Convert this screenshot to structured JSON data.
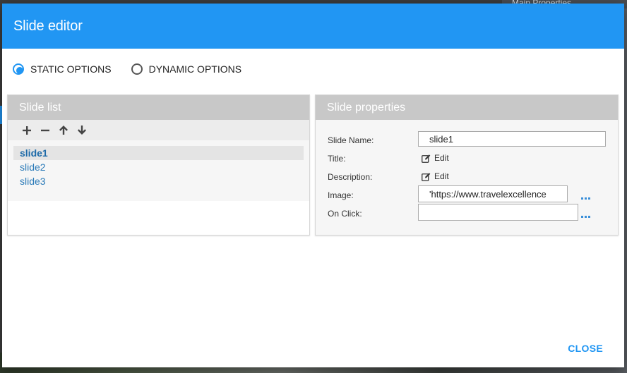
{
  "background": {
    "panel_title": "Main Properties"
  },
  "modal": {
    "title": "Slide editor",
    "options": [
      {
        "label": "STATIC OPTIONS",
        "checked": true
      },
      {
        "label": "DYNAMIC OPTIONS",
        "checked": false
      }
    ],
    "close_label": "CLOSE"
  },
  "slide_list": {
    "title": "Slide list",
    "toolbar": [
      "plus-icon",
      "minus-icon",
      "arrow-up-icon",
      "arrow-down-icon"
    ],
    "items": [
      {
        "label": "slide1",
        "selected": true
      },
      {
        "label": "slide2",
        "selected": false
      },
      {
        "label": "slide3",
        "selected": false
      }
    ]
  },
  "slide_properties": {
    "title": "Slide properties",
    "name_label": "Slide Name:",
    "name_value": "slide1",
    "title_label": "Title:",
    "title_edit": "Edit",
    "description_label": "Description:",
    "description_edit": "Edit",
    "image_label": "Image:",
    "image_value": "'https://www.travelexcellence",
    "onclick_label": "On Click:",
    "onclick_value": ""
  },
  "colors": {
    "accent": "#2196f3",
    "header_gray": "#c8c8c8",
    "link_blue": "#2a7ab8"
  }
}
